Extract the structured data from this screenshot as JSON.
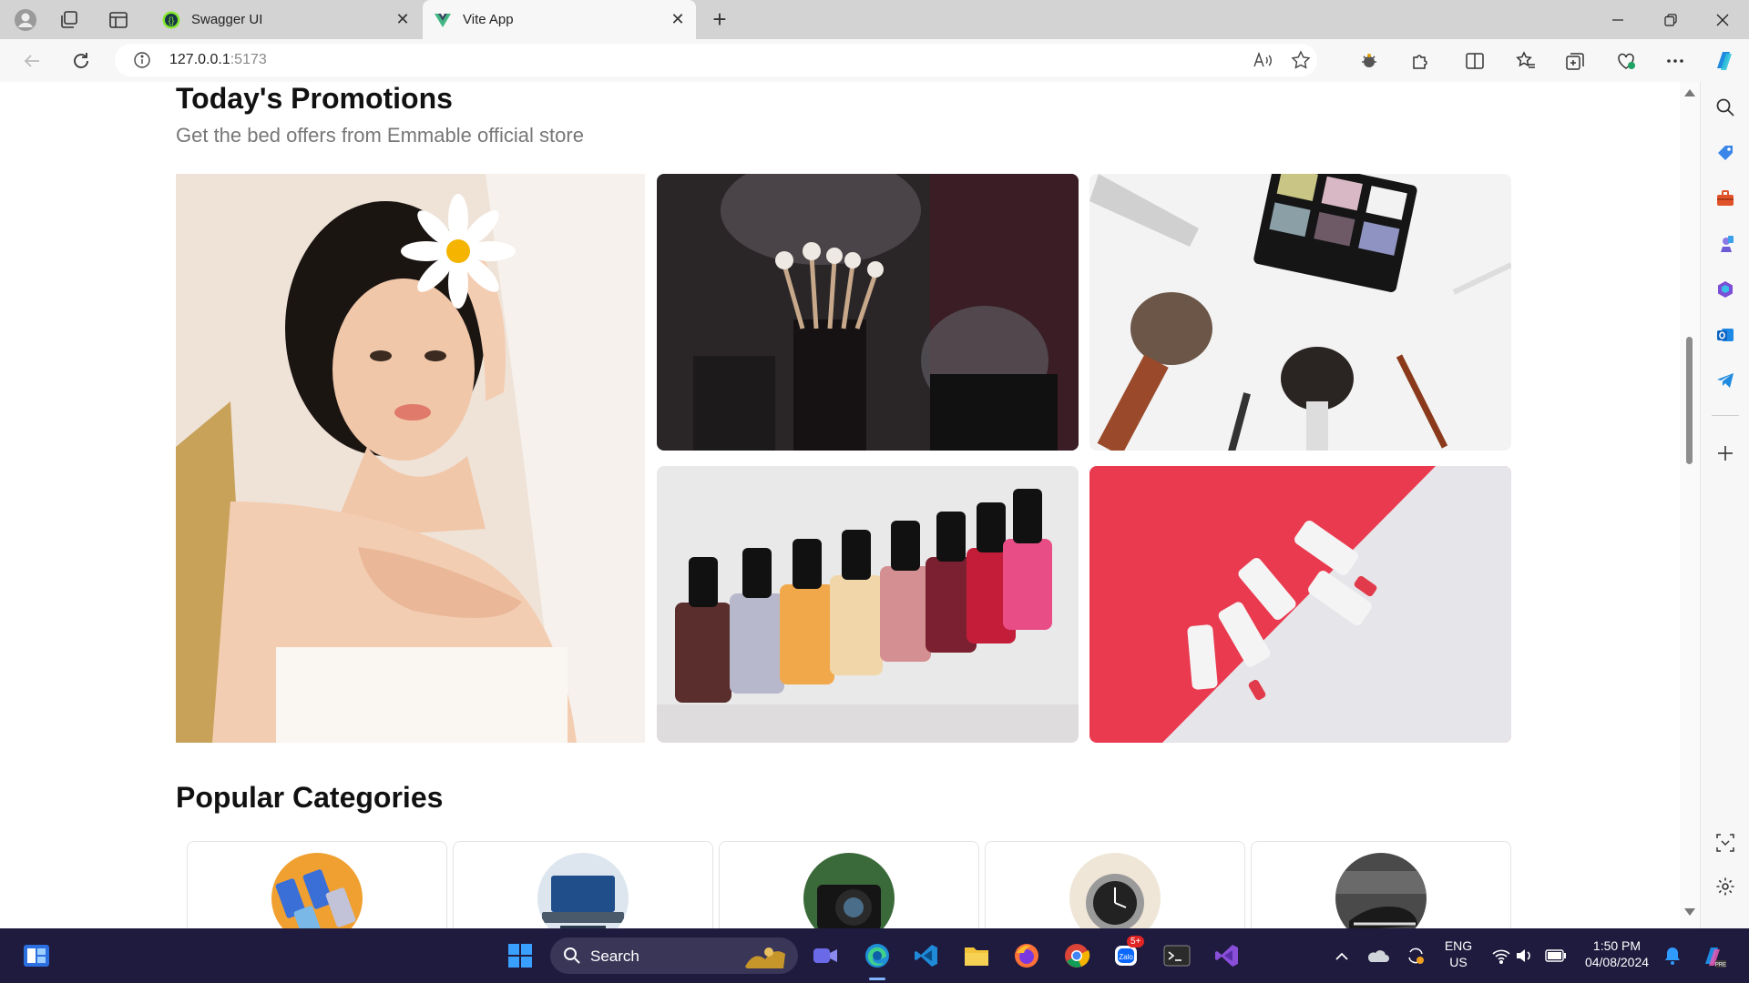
{
  "browser": {
    "tabs": [
      {
        "title": "Swagger UI",
        "active": false
      },
      {
        "title": "Vite App",
        "active": true
      }
    ],
    "url": "127.0.0.1:5173",
    "url_host": "127.0.0.1",
    "url_port": ":5173"
  },
  "promotions": {
    "title": "Today's Promotions",
    "subtitle": "Get the bed offers from Emmable official store"
  },
  "categories": {
    "title": "Popular Categories"
  },
  "taskbar": {
    "search_label": "Search",
    "lang_top": "ENG",
    "lang_bottom": "US",
    "time": "1:50 PM",
    "date": "04/08/2024",
    "zalo_badge": "5+"
  },
  "colors": {
    "taskbar_bg": "#1f1b3e",
    "tab_strip_bg": "#d3d3d3",
    "lipstick_red": "#ea3a4f"
  }
}
